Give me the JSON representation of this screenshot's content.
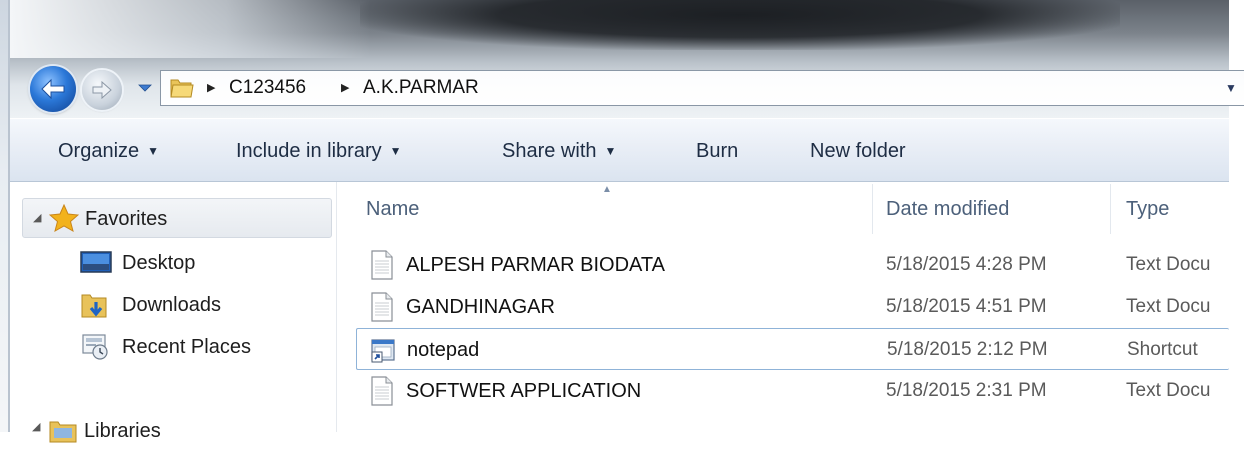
{
  "address_bar": {
    "path": [
      "C123456",
      "A.K.PARMAR"
    ]
  },
  "toolbar": {
    "organize": "Organize",
    "include_in_library": "Include in library",
    "share_with": "Share with",
    "burn": "Burn",
    "new_folder": "New folder"
  },
  "navigation_pane": {
    "favorites": "Favorites",
    "items": [
      "Desktop",
      "Downloads",
      "Recent Places"
    ],
    "libraries": "Libraries"
  },
  "columns": {
    "name": "Name",
    "date_modified": "Date modified",
    "type": "Type"
  },
  "files": [
    {
      "name": "ALPESH PARMAR BIODATA",
      "date": "5/18/2015 4:28 PM",
      "type": "Text Docu",
      "icon": "text-document-icon"
    },
    {
      "name": "GANDHINAGAR",
      "date": "5/18/2015 4:51 PM",
      "type": "Text Docu",
      "icon": "text-document-icon"
    },
    {
      "name": "notepad",
      "date": "5/18/2015 2:12 PM",
      "type": "Shortcut",
      "icon": "shortcut-icon"
    },
    {
      "name": "SOFTWER APPLICATION",
      "date": "5/18/2015 2:31 PM",
      "type": "Text Docu",
      "icon": "text-document-icon"
    }
  ],
  "colors": {
    "command_bar": "#dbe4f0",
    "back_button": "#2b78d8",
    "favorites_star": "#f2b21c",
    "focus_border": "#8fb3d8"
  }
}
